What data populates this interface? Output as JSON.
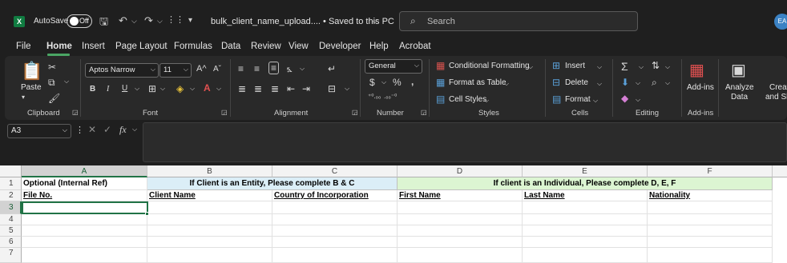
{
  "titlebar": {
    "logo": "X",
    "autosave_label": "AutoSave",
    "autosave_state": "Off",
    "doc_title": "bulk_client_name_upload....  •  Saved to this PC",
    "search_placeholder": "Search",
    "avatar_initials": "EA"
  },
  "menu": {
    "tabs": [
      "File",
      "Home",
      "Insert",
      "Page Layout",
      "Formulas",
      "Data",
      "Review",
      "View",
      "Developer",
      "Help",
      "Acrobat"
    ],
    "active_tab": "Home"
  },
  "ribbon": {
    "clipboard": {
      "paste_label": "Paste",
      "group_label": "Clipboard"
    },
    "font": {
      "font_name": "Aptos Narrow",
      "font_size": "11",
      "group_label": "Font"
    },
    "alignment": {
      "group_label": "Alignment"
    },
    "number": {
      "format": "General",
      "group_label": "Number"
    },
    "styles": {
      "conditional_formatting": "Conditional Formatting",
      "format_as_table": "Format as Table",
      "cell_styles": "Cell Styles",
      "group_label": "Styles"
    },
    "cells": {
      "insert": "Insert",
      "delete": "Delete",
      "format": "Format",
      "group_label": "Cells"
    },
    "editing": {
      "group_label": "Editing"
    },
    "addins": {
      "addins_label": "Add-ins",
      "group_label": "Add-ins"
    },
    "analyze": {
      "label_line1": "Analyze",
      "label_line2": "Data"
    },
    "create": {
      "label_line1": "Creat",
      "label_line2": "and Sh"
    }
  },
  "formula_bar": {
    "name_box": "A3",
    "fx": "fx"
  },
  "sheet": {
    "columns": [
      "A",
      "B",
      "C",
      "D",
      "E",
      "F"
    ],
    "selected_column": "A",
    "rows": [
      "1",
      "2",
      "3",
      "4",
      "5",
      "6",
      "7"
    ],
    "selected_row": "3",
    "row1": {
      "a": "Optional (Internal Ref)",
      "bc_merged": "If Client is an Entity, Please complete B & C",
      "def_merged": "If client is an Individual, Please complete D, E, F"
    },
    "row2": {
      "a": "File No.",
      "b": "Client Name",
      "c": "Country of Incorporation",
      "d": "First Name",
      "e": "Last Name",
      "f": "Nationality"
    },
    "colors": {
      "entity_fill": "#dbeef7",
      "individual_fill": "#dcf5d2",
      "accent": "#217346"
    }
  }
}
